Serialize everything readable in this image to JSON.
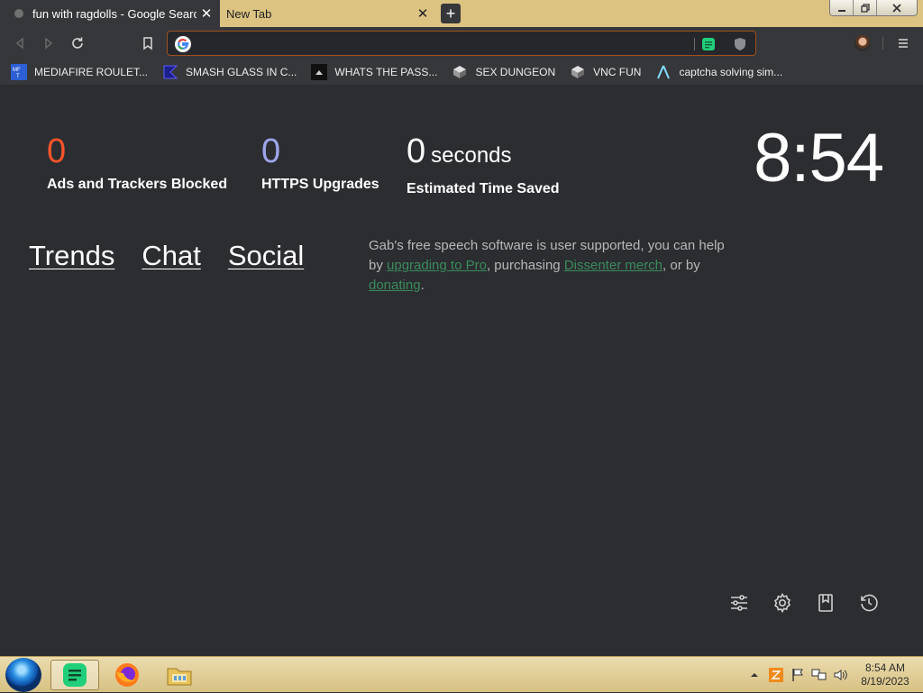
{
  "browser": {
    "tabs": [
      {
        "title": "fun with ragdolls - Google Search",
        "active": true
      },
      {
        "title": "New Tab",
        "active": false
      }
    ],
    "omnibox": {
      "value": "",
      "placeholder": ""
    },
    "bookmarks": [
      {
        "label": "MEDIAFIRE ROULET...",
        "icon": "mediafire-icon"
      },
      {
        "label": "SMASH GLASS IN C...",
        "icon": "smash-glass-icon"
      },
      {
        "label": "WHATS THE PASS...",
        "icon": "pass-icon"
      },
      {
        "label": "SEX DUNGEON",
        "icon": "dungeon-icon"
      },
      {
        "label": "VNC FUN",
        "icon": "vnc-icon"
      },
      {
        "label": "captcha solving sim...",
        "icon": "captcha-icon"
      }
    ]
  },
  "newtab": {
    "stats": {
      "ads": {
        "value": "0",
        "label": "Ads and Trackers Blocked"
      },
      "https": {
        "value": "0",
        "label": "HTTPS Upgrades"
      },
      "time": {
        "value": "0",
        "unit": "seconds",
        "label": "Estimated Time Saved"
      }
    },
    "clock": "8:54",
    "links": [
      "Trends",
      "Chat",
      "Social"
    ],
    "support": {
      "text_1": "Gab's free speech software is user supported, you can help by ",
      "link_1": "upgrading to Pro",
      "text_2": ", purchasing ",
      "link_2": "Dissenter merch",
      "text_3": ", or by ",
      "link_3": "donating",
      "text_4": "."
    }
  },
  "taskbar": {
    "time": "8:54 AM",
    "date": "8/19/2023"
  },
  "colors": {
    "ads_accent": "#fb542b",
    "https_accent": "#a0a5eb",
    "link_green": "#3b8b5c",
    "tab_strip": "#dcc382",
    "page_bg": "#2b2d31"
  }
}
